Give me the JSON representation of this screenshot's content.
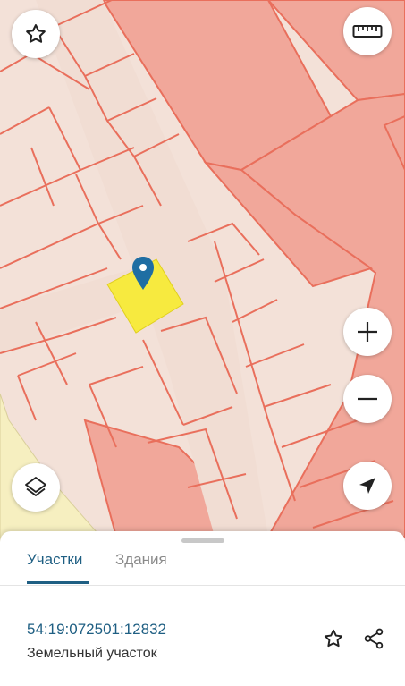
{
  "map": {
    "colors": {
      "background": "#f3e1d8",
      "zone": "#f1a79a",
      "parcel_border": "#e96f5c",
      "road": "#f1ddd3",
      "green_zone": "#f6efc0",
      "selected_parcel": "#f7ea3f",
      "pin": "#1f6ea3"
    },
    "buttons": {
      "favorite_icon": "star-outline-icon",
      "ruler_icon": "ruler-icon",
      "zoom_in_icon": "plus-icon",
      "zoom_out_icon": "minus-icon",
      "layers_icon": "layers-icon",
      "location_icon": "navigation-arrow-icon"
    }
  },
  "sheet": {
    "tabs": [
      {
        "label": "Участки",
        "active": true
      },
      {
        "label": "Здания",
        "active": false
      }
    ],
    "parcel": {
      "cadastral_number": "54:19:072501:12832",
      "type": "Земельный участок"
    },
    "actions": {
      "favorite_icon": "star-outline-icon",
      "share_icon": "share-icon"
    }
  }
}
